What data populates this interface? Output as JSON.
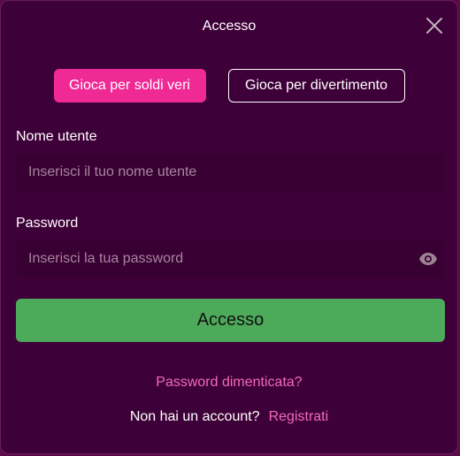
{
  "dialog": {
    "title": "Accesso",
    "close_icon": "close-icon"
  },
  "mode_tabs": {
    "real_money": "Gioca per soldi veri",
    "fun": "Gioca per divertimento",
    "active": "real_money"
  },
  "username": {
    "label": "Nome utente",
    "placeholder": "Inserisci il tuo nome utente",
    "value": ""
  },
  "password": {
    "label": "Password",
    "placeholder": "Inserisci la tua password",
    "value": "",
    "toggle_icon": "eye-icon"
  },
  "submit": {
    "label": "Accesso"
  },
  "links": {
    "forgot_password": "Password dimenticata?",
    "no_account": "Non hai un account?",
    "register": "Registrati"
  },
  "colors": {
    "background": "#3e0038",
    "accent_pink": "#f02a95",
    "link_pink": "#f06bb8",
    "submit_green": "#4caa5a"
  }
}
